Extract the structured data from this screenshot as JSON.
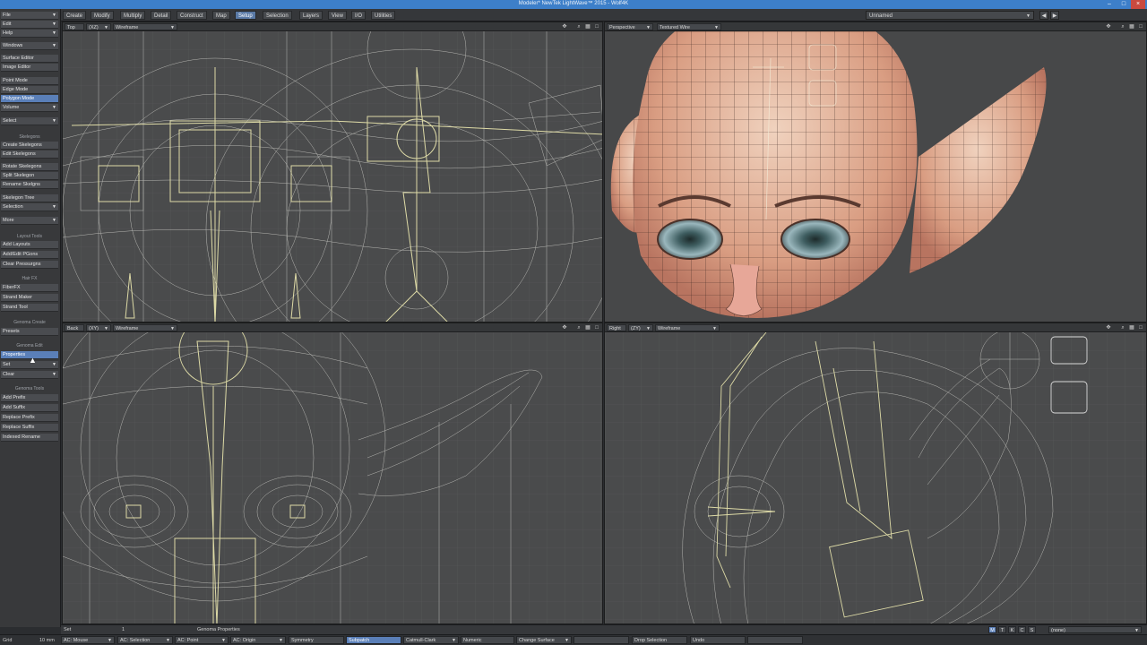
{
  "app": {
    "title": "Modeler* NewTek LightWave™ 2015  - Wolf4K",
    "window_controls": [
      "–",
      "□",
      "×"
    ]
  },
  "tabs": [
    "Create",
    "Modify",
    "Multiply",
    "Detail",
    "Construct",
    "Map",
    "Setup",
    "Selection",
    "Layers",
    "View",
    "I/O",
    "Utilities"
  ],
  "active_tab": "Setup",
  "layer_dropdown": "Unnamed",
  "toolbar": {
    "top_menus": [
      "File",
      "Edit",
      "Help"
    ],
    "groups": [
      {
        "items": [
          {
            "label": "Windows",
            "dd": true
          }
        ]
      },
      {
        "items": [
          {
            "label": "Surface Editor"
          },
          {
            "label": "Image Editor"
          }
        ]
      },
      {
        "items": [
          {
            "label": "Point Mode"
          },
          {
            "label": "Edge Mode"
          },
          {
            "label": "Polygon Mode",
            "selected": true
          },
          {
            "label": "Volume",
            "dd": true
          }
        ]
      },
      {
        "items": [
          {
            "label": "Select",
            "dd": true
          }
        ]
      }
    ],
    "sections": [
      {
        "header": "Skelegons",
        "items": [
          {
            "label": "Create Skelegons"
          },
          {
            "label": "Edit Skelegons"
          },
          {
            "label": "Rotate Skelegons"
          },
          {
            "label": "Split Skelegon"
          },
          {
            "label": "Rename Skelgns"
          },
          {
            "label": "Skelegon Tree"
          },
          {
            "label": "Selection",
            "dd": true
          },
          {
            "label": "More",
            "dd": true
          }
        ]
      },
      {
        "header": "Layout Tools",
        "items": [
          {
            "label": "Add Layouts"
          },
          {
            "label": "Add/Edit PGons"
          },
          {
            "label": "Clear Pressurgns"
          }
        ]
      },
      {
        "header": "Hair FX",
        "items": [
          {
            "label": "FiberFX"
          },
          {
            "label": "Strand Maker"
          },
          {
            "label": "Strand Tool"
          }
        ]
      },
      {
        "header": "Genoma Create",
        "items": [
          {
            "label": "Presets"
          }
        ]
      },
      {
        "header": "Genoma Edit",
        "items": [
          {
            "label": "Properties",
            "selected": true
          },
          {
            "label": "Set",
            "dd": true
          },
          {
            "label": "Clear",
            "dd": true
          }
        ]
      },
      {
        "header": "Genoma Tools",
        "items": [
          {
            "label": "Add Prefix"
          },
          {
            "label": "Add Suffix"
          },
          {
            "label": "Replace Prefix"
          },
          {
            "label": "Replace Suffix"
          },
          {
            "label": "Indexed Rename"
          }
        ]
      }
    ]
  },
  "viewports": [
    {
      "id": "top",
      "view": "Top",
      "axes": "(XZ)",
      "mode": "Wireframe"
    },
    {
      "id": "perspective",
      "view": "Perspective",
      "axes": "",
      "mode": "Textured Wire"
    },
    {
      "id": "back",
      "view": "Back",
      "axes": "(XY)",
      "mode": "Wireframe"
    },
    {
      "id": "right",
      "view": "Right",
      "axes": "(ZY)",
      "mode": "Wireframe"
    }
  ],
  "viewport_icons": [
    "move-icon",
    "zoom-icon",
    "grid-icon",
    "maximize-icon"
  ],
  "status": {
    "set_label": "Set",
    "value": "1",
    "command": "Genoma Properties",
    "mode_buttons": [
      "M",
      "T",
      "K",
      "C",
      "S"
    ],
    "active_mode": "M",
    "right_dropdown": "(none)"
  },
  "bottom": {
    "grid_label": "Grid",
    "grid_value": "10 mm",
    "controls": [
      {
        "label": "AC: Mouse",
        "dd": true
      },
      {
        "label": "AC: Selection",
        "dd": true
      },
      {
        "label": "AC: Point",
        "dd": true
      },
      {
        "label": "AC: Origin",
        "dd": true
      },
      {
        "label": "Symmetry"
      },
      {
        "label": "Subpatch",
        "active": true
      },
      {
        "label": "Catmull-Clark",
        "dd": true
      },
      {
        "label": "Numeric"
      },
      {
        "label": "Change Surface",
        "dd": true
      },
      {
        "label": ""
      },
      {
        "label": "Drop Selection"
      },
      {
        "label": "Undo"
      },
      {
        "label": ""
      }
    ]
  },
  "colors": {
    "accent": "#5a7fb8",
    "titlebar": "#3d7fc9",
    "viewport_bg": "#4a4b4c",
    "wire": "#c9c9c4",
    "skelegon": "#eeeab0",
    "skin": "#d9a58a"
  }
}
